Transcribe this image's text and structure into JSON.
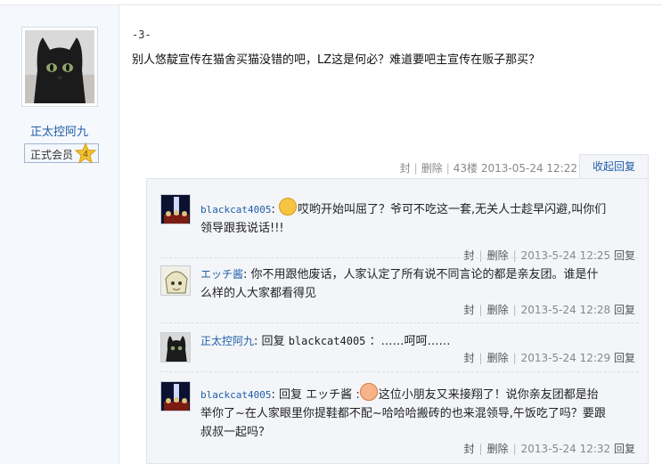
{
  "user": {
    "name": "正太控阿九",
    "rank_label": "正式会员",
    "rank_level": "4"
  },
  "post": {
    "floor_mark": "-3-",
    "text": "别人悠靛宣传在猫舍买猫没错的吧，LZ这是何必？难道要吧主宣传在贩子那买？",
    "meta": {
      "block": "封",
      "delete": "删除",
      "floor": "43楼",
      "time": "2013-05-24 12:22"
    },
    "collapse_label": "收起回复"
  },
  "replies": [
    {
      "user": "blackcat4005",
      "text_a": "哎哟开始叫屈了？爷可不吃这一套,无关人士趁早闪避,叫你们",
      "text_b": "领导跟我说话!!!",
      "block": "封",
      "delete": "删除",
      "time": "2013-5-24 12:25",
      "reply": "回复"
    },
    {
      "user": "エッチ酱",
      "text_a": "你不用跟他废话，人家认定了所有说不同言论的都是亲友团。谁是什",
      "text_b": "么样的人大家都看得见",
      "block": "封",
      "delete": "删除",
      "time": "2013-5-24 12:28",
      "reply": "回复"
    },
    {
      "user": "正太控阿九",
      "reply_prefix": "回复",
      "reply_target": "blackcat4005",
      "text_a": "：……呵呵……",
      "block": "封",
      "delete": "删除",
      "time": "2013-5-24 12:29",
      "reply": "回复"
    },
    {
      "user": "blackcat4005",
      "reply_prefix": "回复",
      "reply_target": "エッチ酱",
      "text_a": "这位小朋友又来接翔了！说你亲友团都是抬",
      "text_b": "举你了~在人家眼里你提鞋都不配~哈哈哈搬砖的也来混领导,午饭吃了吗？要跟",
      "text_c": "叔叔一起吗？",
      "block": "封",
      "delete": "删除",
      "time": "2013-5-24 12:32",
      "reply": "回复"
    }
  ]
}
